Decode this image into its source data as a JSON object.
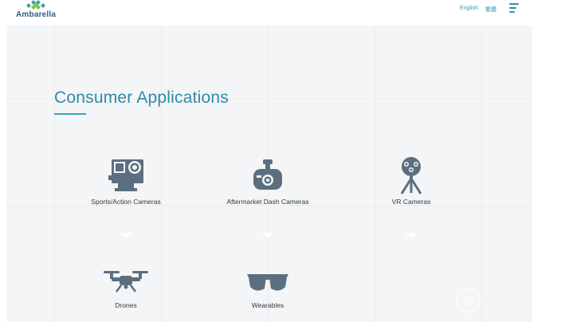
{
  "header": {
    "logo_text": "Ambarella",
    "lang_en": "English",
    "lang_tc": "繁體"
  },
  "section": {
    "title": "Consumer Applications"
  },
  "applications": [
    {
      "label": "Sports/Action Cameras",
      "icon": "action-camera-icon"
    },
    {
      "label": "Aftermarket Dash Cameras",
      "icon": "dash-camera-icon"
    },
    {
      "label": "VR Cameras",
      "icon": "vr-camera-icon"
    },
    {
      "label": "Drones",
      "icon": "drone-icon"
    },
    {
      "label": "Wearables",
      "icon": "smart-glasses-icon"
    }
  ],
  "colors": {
    "accent": "#2f8aa9",
    "icon": "#5b6f80",
    "logo": "#2f5f83",
    "background": "#f4f5f6"
  }
}
